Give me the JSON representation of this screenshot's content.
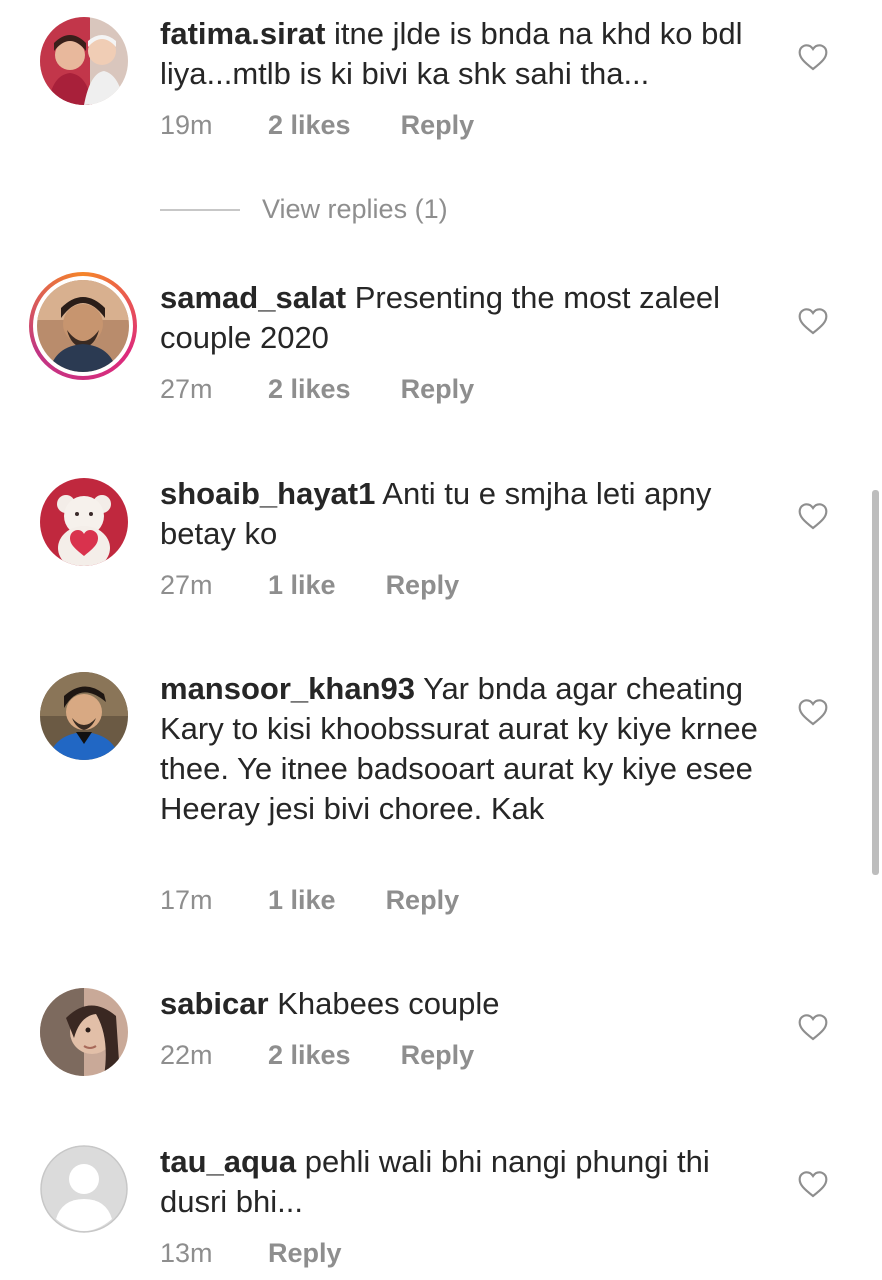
{
  "comments": [
    {
      "username": "fatima.sirat",
      "text": "itne jlde is bnda na khd ko bdl liya...mtlb is ki bivi ka shk sahi tha...",
      "time": "19m",
      "likes": "2 likes",
      "reply": "Reply"
    },
    {
      "username": "samad_salat",
      "text": "Presenting the most zaleel couple 2020",
      "time": "27m",
      "likes": "2 likes",
      "reply": "Reply"
    },
    {
      "username": "shoaib_hayat1",
      "text": "Anti tu e smjha leti apny betay ko",
      "time": "27m",
      "likes": "1 like",
      "reply": "Reply"
    },
    {
      "username": "mansoor_khan93",
      "text": "Yar bnda agar cheating Kary to kisi khoobssurat aurat ky kiye krnee thee. Ye itnee badsooart aurat ky kiye esee Heeray jesi bivi choree. Kak",
      "time": "17m",
      "likes": "1 like",
      "reply": "Reply"
    },
    {
      "username": "sabicar",
      "text": "Khabees couple",
      "time": "22m",
      "likes": "2 likes",
      "reply": "Reply"
    },
    {
      "username": "tau_aqua",
      "text": "pehli wali bhi nangi phungi thi dusri bhi...",
      "time": "13m",
      "likes": "",
      "reply": "Reply"
    }
  ],
  "view_replies": "View replies (1)",
  "icons": {
    "like": "heart-outline-icon"
  },
  "colors": {
    "text": "#262626",
    "meta": "#8e8e8e",
    "story_ring_start": "#f58529",
    "story_ring_end": "#dd2a7b"
  }
}
